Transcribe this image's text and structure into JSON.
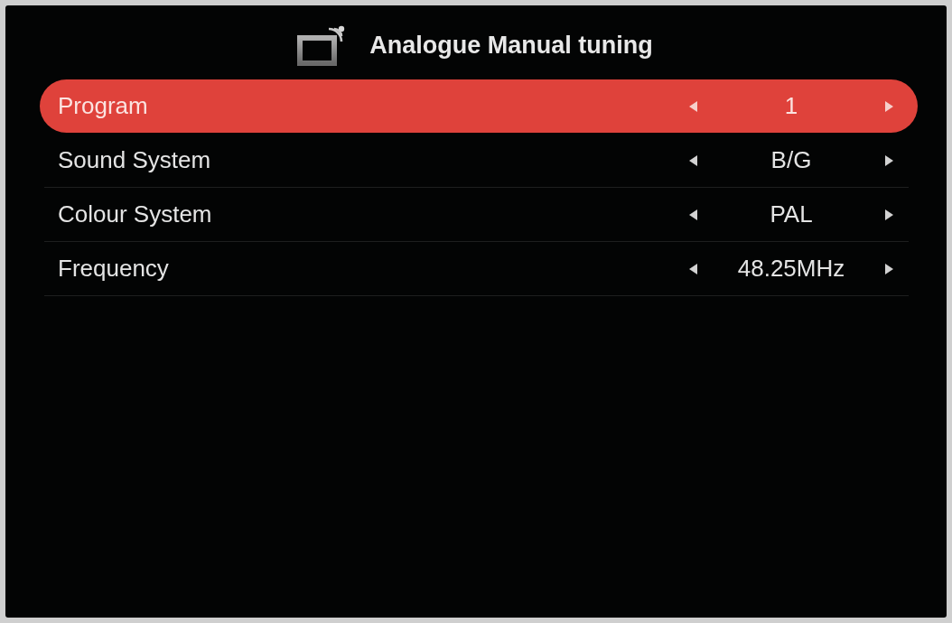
{
  "title": "Analogue Manual tuning",
  "rows": [
    {
      "label": "Program",
      "value": "1",
      "selected": true
    },
    {
      "label": "Sound System",
      "value": "B/G",
      "selected": false
    },
    {
      "label": "Colour System",
      "value": "PAL",
      "selected": false
    },
    {
      "label": "Frequency",
      "value": "48.25MHz",
      "selected": false
    }
  ]
}
